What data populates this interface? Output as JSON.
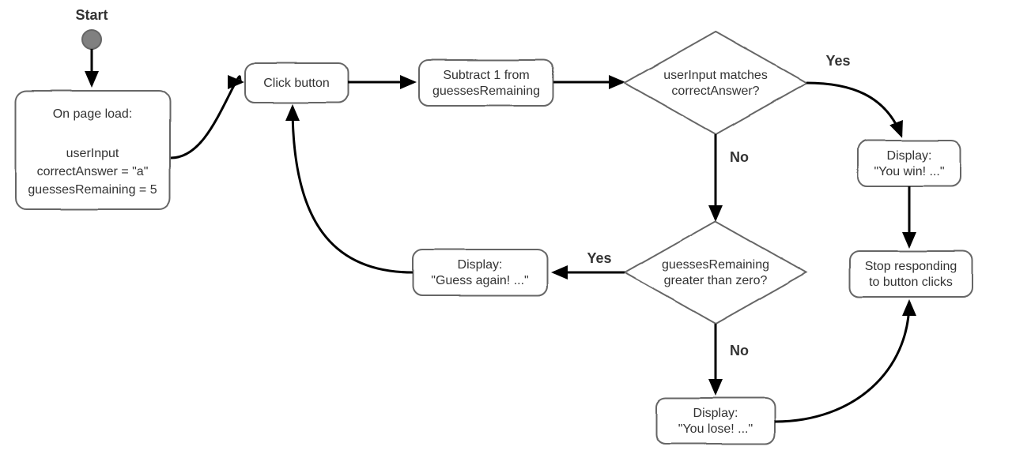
{
  "start_label": "Start",
  "nodes": {
    "pageload": {
      "line1": "On page load:",
      "line2": "userInput",
      "line3": "correctAnswer = \"a\"",
      "line4": "guessesRemaining = 5"
    },
    "click_button": "Click button",
    "subtract": {
      "line1": "Subtract 1 from",
      "line2": "guessesRemaining"
    },
    "decision1": {
      "line1": "userInput matches",
      "line2": "correctAnswer?"
    },
    "win": {
      "line1": "Display:",
      "line2": "\"You win! ...\""
    },
    "decision2": {
      "line1": "guessesRemaining",
      "line2": "greater than zero?"
    },
    "guess_again": {
      "line1": "Display:",
      "line2": "\"Guess again! ...\""
    },
    "lose": {
      "line1": "Display:",
      "line2": "\"You lose! ...\""
    },
    "stop": {
      "line1": "Stop responding",
      "line2": "to button clicks"
    }
  },
  "edge_labels": {
    "yes1": "Yes",
    "no1": "No",
    "yes2": "Yes",
    "no2": "No"
  },
  "colors": {
    "stroke": "#666666",
    "text": "#333333",
    "startFill": "#808080",
    "arrow": "#000000"
  }
}
